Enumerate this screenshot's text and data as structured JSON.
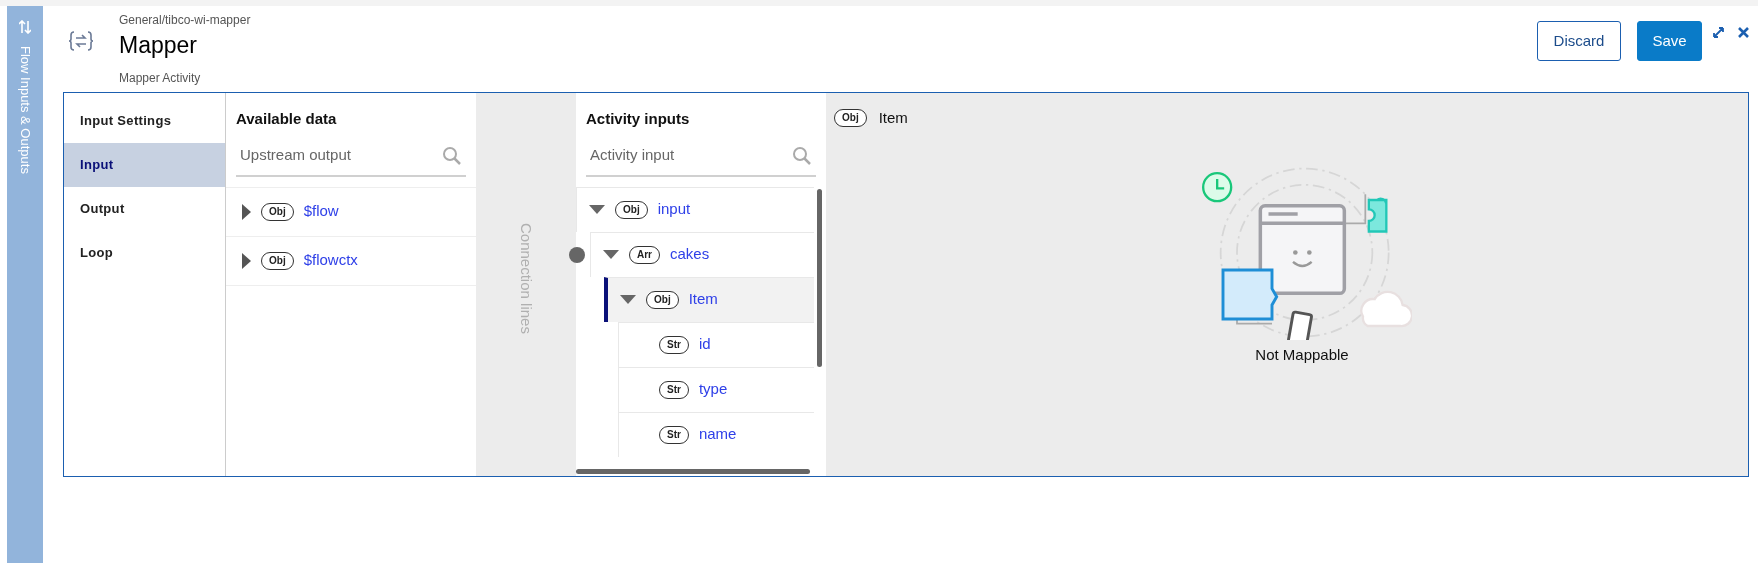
{
  "side_tab": {
    "label": "Flow Inputs & Outputs"
  },
  "header": {
    "breadcrumb": "General/tibco-wi-mapper",
    "title": "Mapper",
    "subtitle": "Mapper Activity",
    "buttons": [
      {
        "label": "Discard",
        "kind": "secondary"
      },
      {
        "label": "Save",
        "kind": "primary"
      }
    ]
  },
  "nav": [
    {
      "label": "Input Settings",
      "selected": false
    },
    {
      "label": "Input",
      "selected": true
    },
    {
      "label": "Output",
      "selected": false
    },
    {
      "label": "Loop",
      "selected": false
    }
  ],
  "available_data": {
    "title": "Available data",
    "search": {
      "placeholder": "Upstream output"
    },
    "items": [
      {
        "type": "Obj",
        "name": "$flow",
        "expanded": false
      },
      {
        "type": "Obj",
        "name": "$flowctx",
        "expanded": false
      }
    ]
  },
  "connection_lines": {
    "label": "Connection lines"
  },
  "activity_inputs": {
    "title": "Activity inputs",
    "search": {
      "placeholder": "Activity input"
    },
    "items": [
      {
        "type": "Obj",
        "name": "input",
        "expanded": true,
        "selected": false,
        "mapped": false,
        "children": [
          {
            "type": "Arr",
            "name": "cakes",
            "expanded": true,
            "selected": false,
            "mapped": true,
            "children": [
              {
                "type": "Obj",
                "name": "Item",
                "expanded": true,
                "selected": true,
                "mapped": false,
                "children": [
                  {
                    "type": "Str",
                    "name": "id",
                    "selected": false,
                    "mapped": false
                  },
                  {
                    "type": "Str",
                    "name": "type",
                    "selected": false,
                    "mapped": false
                  },
                  {
                    "type": "Str",
                    "name": "name",
                    "selected": false,
                    "mapped": false
                  }
                ]
              }
            ]
          }
        ]
      }
    ]
  },
  "detail": {
    "type": "Obj",
    "name": "Item",
    "message": "Not Mappable"
  }
}
